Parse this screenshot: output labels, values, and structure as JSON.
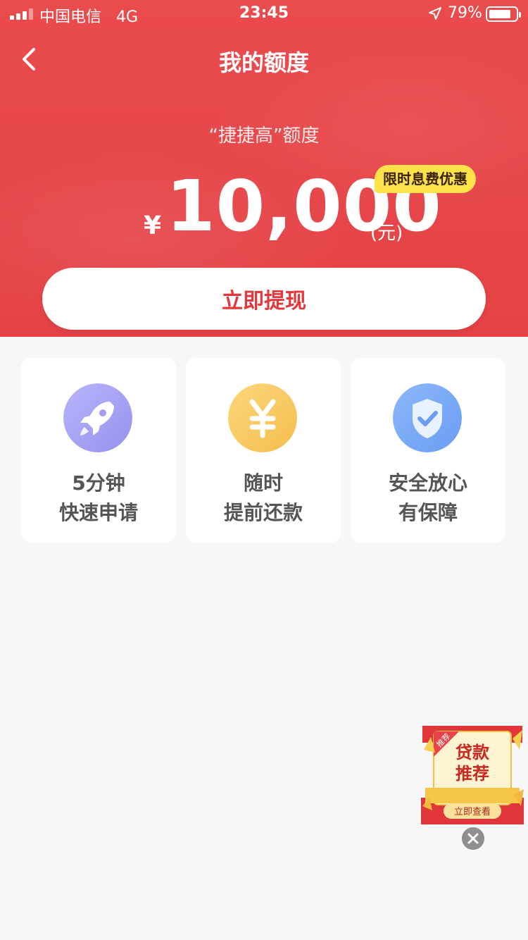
{
  "status_bar": {
    "carrier": "中国电信",
    "network": "4G",
    "time": "23:45",
    "battery_percent": "79%",
    "battery_level": 0.79
  },
  "nav": {
    "title": "我的额度",
    "back_icon": "chevron-left-icon"
  },
  "quota": {
    "label": "“捷捷高”额度",
    "currency_symbol": "¥",
    "amount": "10,000",
    "unit": "(元)",
    "promo_badge": "限时息费优惠"
  },
  "cta": {
    "label": "立即提现"
  },
  "features": [
    {
      "icon": "rocket-icon",
      "line1": "5分钟",
      "line2": "快速申请",
      "color": "#a9a4f5"
    },
    {
      "icon": "yen-icon",
      "line1": "随时",
      "line2": "提前还款",
      "color": "#f9c861"
    },
    {
      "icon": "shield-check-icon",
      "line1": "安全放心",
      "line2": "有保障",
      "color": "#79a9f6"
    }
  ],
  "floating_ad": {
    "corner_tag": "推荐",
    "title_line1": "贷款",
    "title_line2": "推荐",
    "button_label": "立即查看",
    "close_icon": "close-icon"
  },
  "colors": {
    "brand_red": "#e5474a",
    "promo_yellow": "#fde24a",
    "page_bg": "#f7f7f7"
  }
}
